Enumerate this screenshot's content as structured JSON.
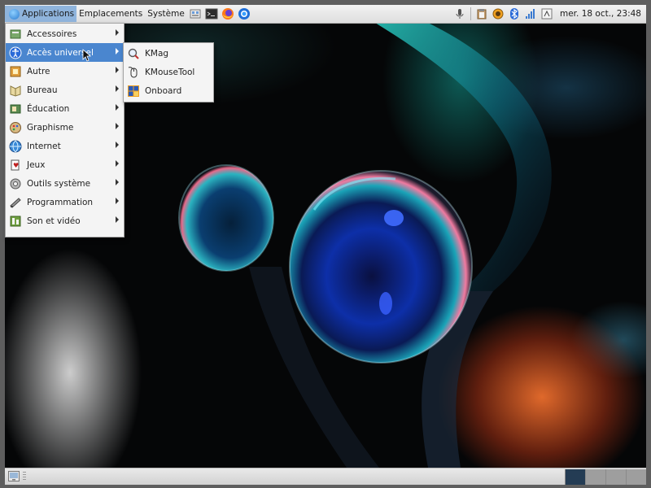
{
  "top_panel": {
    "menus": [
      "Applications",
      "Emplacements",
      "Système"
    ],
    "launchers": [
      "file-manager-icon",
      "terminal-icon",
      "firefox-icon",
      "thunderbird-icon"
    ],
    "clock": "mer. 18 oct., 23:48"
  },
  "applications_menu": {
    "items": [
      {
        "label": "Accessoires",
        "icon": "accessories-icon"
      },
      {
        "label": "Accès universel",
        "icon": "accessibility-icon",
        "highlighted": true
      },
      {
        "label": "Autre",
        "icon": "other-icon"
      },
      {
        "label": "Bureau",
        "icon": "office-icon"
      },
      {
        "label": "Éducation",
        "icon": "education-icon"
      },
      {
        "label": "Graphisme",
        "icon": "graphics-icon"
      },
      {
        "label": "Internet",
        "icon": "internet-icon"
      },
      {
        "label": "Jeux",
        "icon": "games-icon"
      },
      {
        "label": "Outils système",
        "icon": "system-tools-icon"
      },
      {
        "label": "Programmation",
        "icon": "programming-icon"
      },
      {
        "label": "Son et vidéo",
        "icon": "sound-video-icon"
      }
    ]
  },
  "accessibility_submenu": {
    "items": [
      {
        "label": "KMag",
        "icon": "kmag-icon"
      },
      {
        "label": "KMouseTool",
        "icon": "kmousetool-icon"
      },
      {
        "label": "Onboard",
        "icon": "onboard-icon"
      }
    ]
  },
  "colors": {
    "highlight": "#4a86cf",
    "panel": "#e6e6e6",
    "active_workspace": "#243c54"
  }
}
